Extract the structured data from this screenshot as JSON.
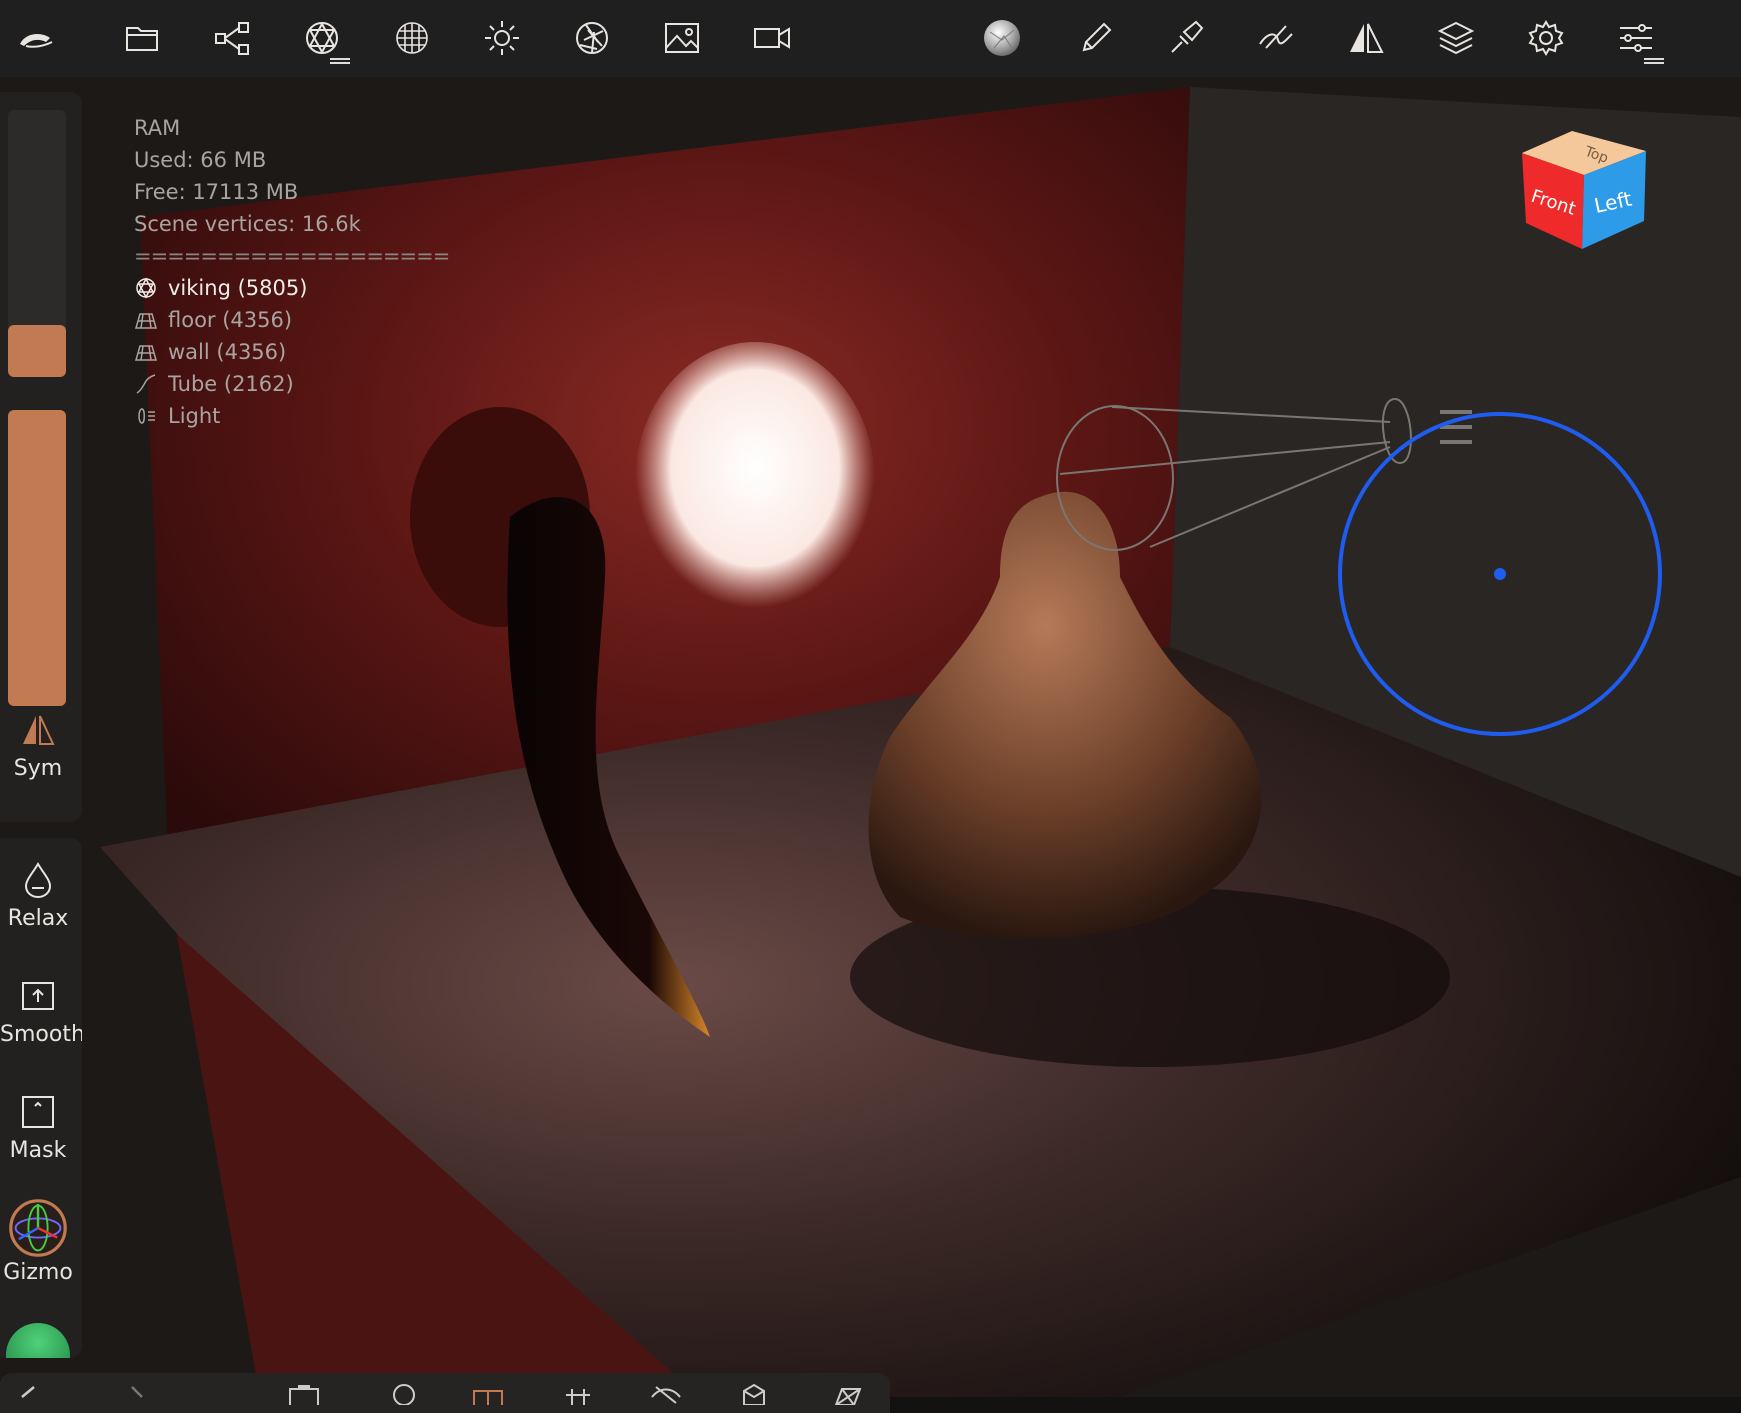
{
  "stats": {
    "title": "RAM",
    "used": "Used: 66 MB",
    "free": "Free: 17113 MB",
    "vertices": "Scene vertices: 16.6k",
    "separator": "===================",
    "objects": [
      {
        "icon": "sphere-mesh-icon",
        "label": "viking (5805)",
        "active": true
      },
      {
        "icon": "plane-mesh-icon",
        "label": "floor (4356)",
        "active": false
      },
      {
        "icon": "plane-mesh-icon",
        "label": "wall (4356)",
        "active": false
      },
      {
        "icon": "tube-icon",
        "label": "Tube (2162)",
        "active": false
      },
      {
        "icon": "light-icon",
        "label": "Light",
        "active": false
      }
    ]
  },
  "side_tools": {
    "sym": "Sym",
    "relax": "Relax",
    "smooth": "Smooth",
    "mask": "Mask",
    "gizmo": "Gizmo"
  },
  "viewcube": {
    "top": "Top",
    "front": "Front",
    "left": "Left"
  },
  "sliders": {
    "radius_fraction": 0.25,
    "intensity_fraction": 1.0
  },
  "colors": {
    "accent": "#c17a52",
    "selection_ring": "#1f5cf0",
    "toolbar_bg": "#1f1f1f"
  },
  "toolbar_icons": [
    "app-logo-icon",
    "folder-icon",
    "scene-graph-icon",
    "mesh-icon",
    "topology-icon",
    "sun-icon",
    "aperture-icon",
    "image-icon",
    "camera-icon",
    "material-sphere-icon",
    "brush-icon",
    "paint-icon",
    "stroke-icon",
    "symmetry-icon",
    "layers-icon",
    "gear-icon",
    "sliders-icon"
  ]
}
